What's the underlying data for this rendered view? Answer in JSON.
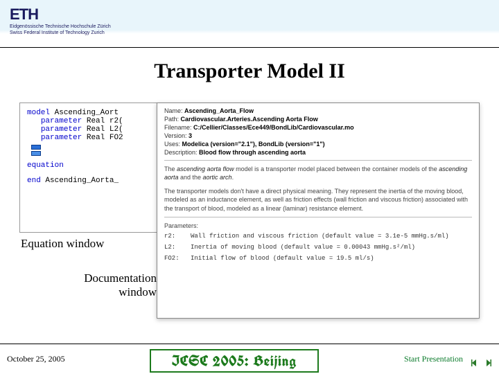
{
  "header": {
    "logo": "ETH",
    "sub1": "Eidgenössische Technische Hochschule Zürich",
    "sub2": "Swiss Federal Institute of Technology Zurich"
  },
  "title": "Transporter Model II",
  "equation_window": {
    "label": "Equation window",
    "line1_kw": "model",
    "line1_name": "Ascending_Aort",
    "line2_kw": "parameter",
    "line2_type": "Real",
    "line2_var": "r2(",
    "line3_kw": "parameter",
    "line3_type": "Real",
    "line3_var": "L2(",
    "line4_kw": "parameter",
    "line4_type": "Real",
    "line4_var": "FO2",
    "eq_kw": "equation",
    "end_kw": "end",
    "end_name": "Ascending_Aorta_"
  },
  "doc_window": {
    "label1": "Documentation",
    "label2": "window",
    "name_lbl": "Name:",
    "name_val": "Ascending_Aorta_Flow",
    "path_lbl": "Path:",
    "path_val": "Cardiovascular.Arteries.Ascending Aorta Flow",
    "file_lbl": "Filename:",
    "file_val": "C:/Cellier/Classes/Ece449/BondLib/Cardiovascular.mo",
    "ver_lbl": "Version:",
    "ver_val": "3",
    "uses_lbl": "Uses:",
    "uses_val": "Modelica (version=\"2.1\"), BondLib (version=\"1\")",
    "desc_lbl": "Description:",
    "desc_val": "Blood flow through ascending aorta",
    "para1a": "The ",
    "para1b": "ascending aorta flow",
    "para1c": " model is a transporter model placed between the container models of the ",
    "para1d": "ascending aorta",
    "para1e": " and the ",
    "para1f": "aortic arch",
    "para1g": ".",
    "para2": "The transporter models don't have a direct physical meaning. They represent the inertia of the moving blood, modeled as an inductance element, as well as friction effects (wall friction and viscous friction) associated with the transport of blood, modeled as a linear (laminar) resistance element.",
    "params_lbl": "Parameters:",
    "p_r2_k": "r2:",
    "p_r2_v": "Wall friction and viscous friction (default value = 3.1e-5 mmHg.s/ml)",
    "p_l2_k": "L2:",
    "p_l2_v": "Inertia of moving blood (default value = 0.00043 mmHg.s²/ml)",
    "p_f02_k": "FO2:",
    "p_f02_v": "Initial flow of blood (default value = 19.5 ml/s)"
  },
  "footer": {
    "date": "October 25, 2005",
    "center": "ICSC 2005: Beijing",
    "start": "Start Presentation"
  }
}
